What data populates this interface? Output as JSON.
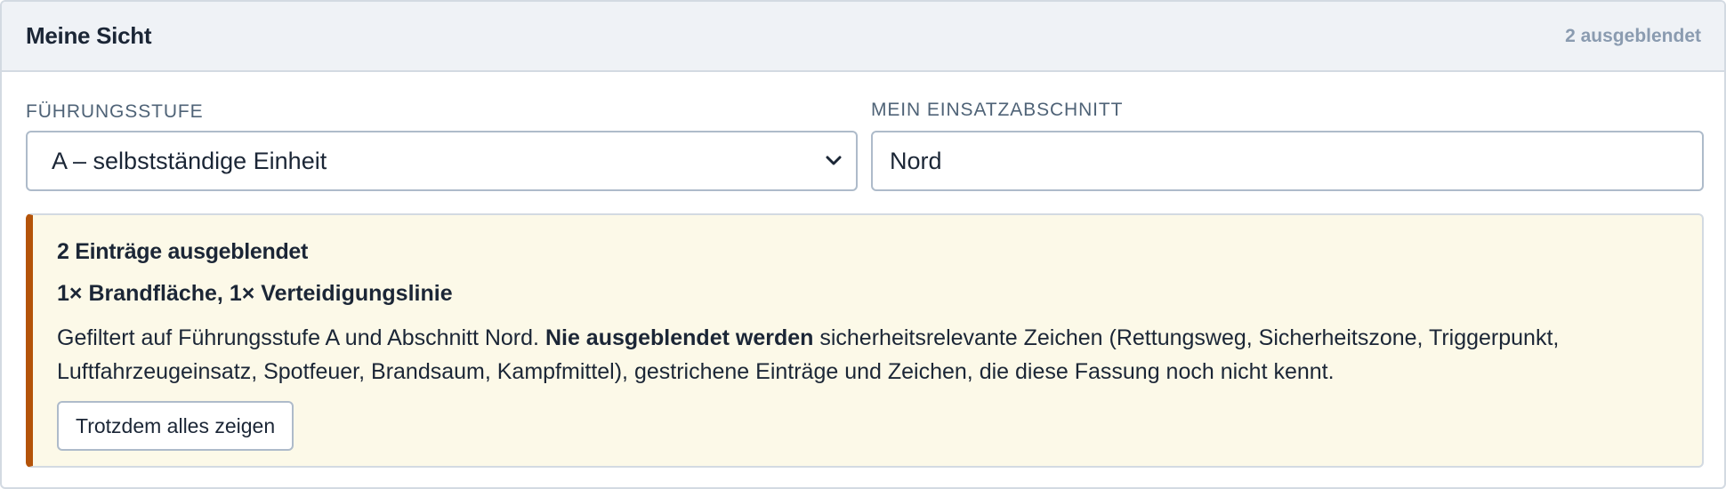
{
  "panel": {
    "title": "Meine Sicht",
    "hidden_count_label": "2 ausgeblendet"
  },
  "fields": {
    "leadership_level": {
      "label": "FÜHRUNGSSTUFE",
      "selected": "A – selbstständige Einheit"
    },
    "sector": {
      "label": "MEIN EINSATZABSCHNITT",
      "value": "Nord"
    }
  },
  "notice": {
    "title": "2 Einträge ausgeblendet",
    "summary": "1× Brandfläche, 1× Verteidigungslinie",
    "body_prefix": "Gefiltert auf Führungsstufe A und Abschnitt Nord. ",
    "body_emphasis": "Nie ausgeblendet werden",
    "body_suffix": " sicherheitsrelevante Zeichen (Rettungsweg, Sicherheitszone, Triggerpunkt, Luftfahrzeugeinsatz, Spotfeuer, Brandsaum, Kampfmittel), gestrichene Einträge und Zeichen, die diese Fassung noch nicht kennt.",
    "button_label": "Trotzdem alles zeigen"
  },
  "colors": {
    "accent_border": "#b45309",
    "notice_background": "#fcf9e8",
    "header_background": "#eff2f6"
  },
  "icons": {
    "select_chevron": "chevron-down-icon"
  }
}
